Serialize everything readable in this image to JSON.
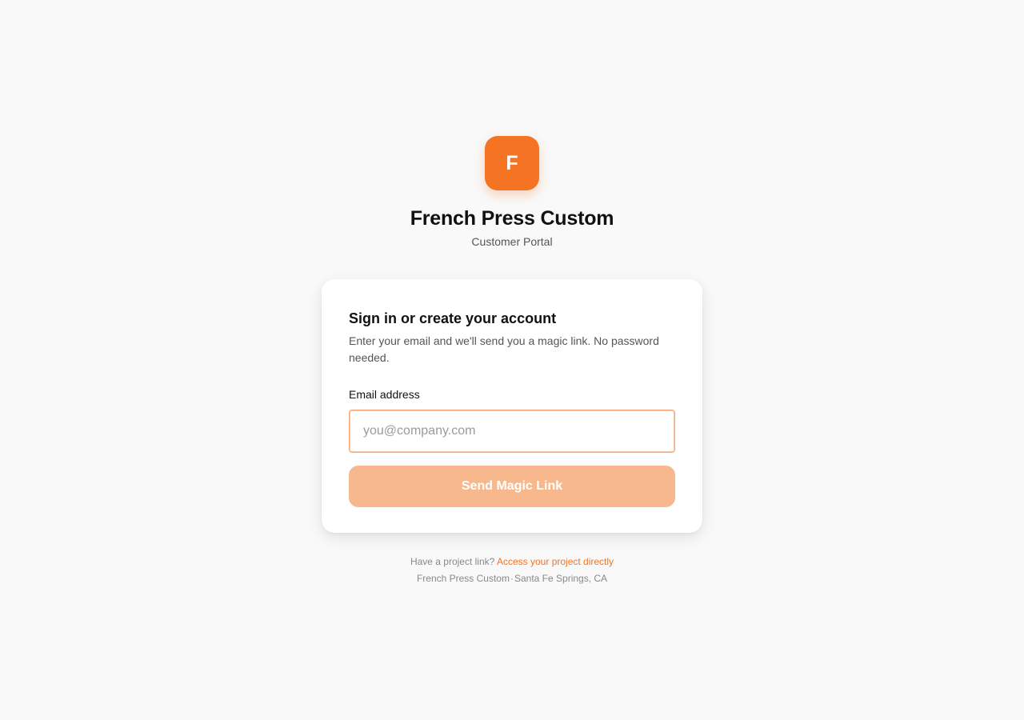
{
  "brand": {
    "logo_letter": "F",
    "title": "French Press Custom",
    "subtitle": "Customer Portal"
  },
  "card": {
    "heading": "Sign in or create your account",
    "description": "Enter your email and we'll send you a magic link. No password needed.",
    "email_label": "Email address",
    "email_placeholder": "you@company.com",
    "email_value": "",
    "button_label": "Send Magic Link"
  },
  "footer": {
    "project_prompt": "Have a project link?",
    "project_link": "Access your project directly",
    "company": "French Press Custom",
    "separator": "·",
    "location": "Santa Fe Springs, CA"
  },
  "colors": {
    "accent": "#f47424",
    "button_disabled": "#f8b88d",
    "background": "#f9f9f9"
  }
}
